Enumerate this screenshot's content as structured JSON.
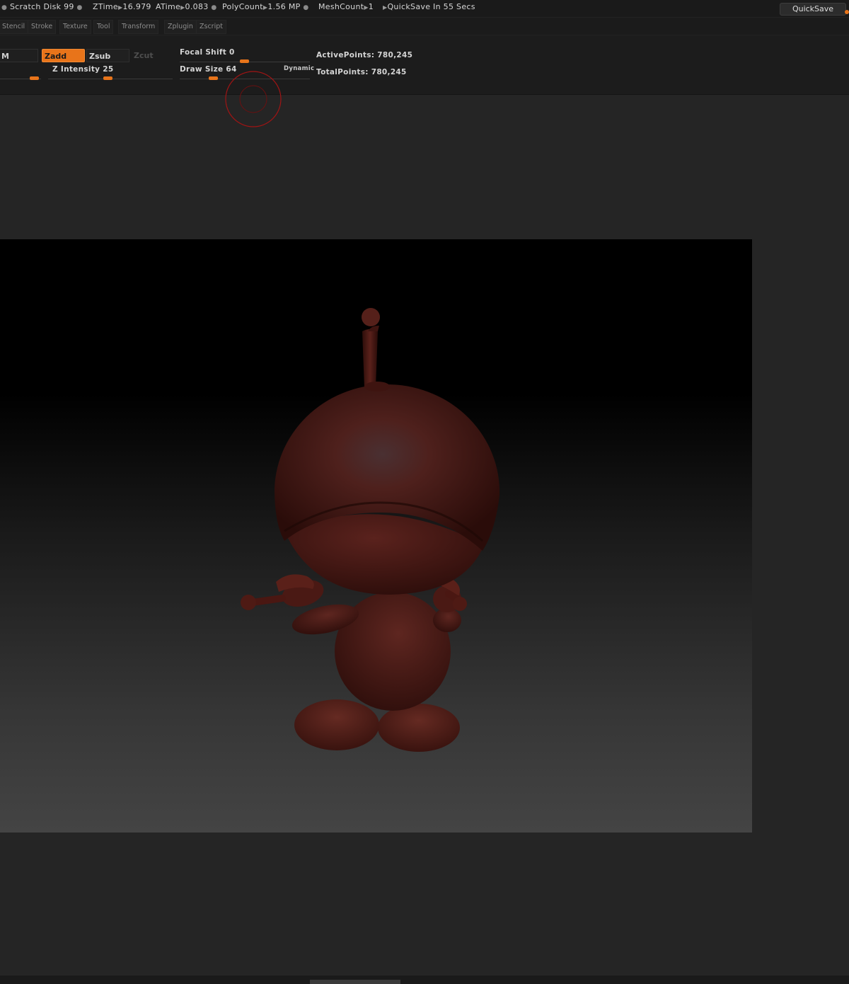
{
  "statusbar": {
    "scratch_disk": "Scratch Disk 99",
    "ztime_label": "ZTime",
    "ztime_value": "16.979",
    "atime_label": "ATime",
    "atime_value": "0.083",
    "polycount_label": "PolyCount",
    "polycount_value": "1.56 MP",
    "meshcount_label": "MeshCount",
    "meshcount_value": "1",
    "quicksave_timer": "QuickSave In 55 Secs",
    "quicksave_button": "QuickSave"
  },
  "menubar": {
    "items": [
      "Stencil",
      "Stroke",
      "Texture",
      "Tool",
      "Transform",
      "Zplugin",
      "Zscript"
    ]
  },
  "shelf": {
    "partial_button": "M",
    "zadd": "Zadd",
    "zsub": "Zsub",
    "zcut": "Zcut",
    "z_intensity_label": "Z Intensity",
    "z_intensity_value": "25",
    "focal_shift_label": "Focal Shift",
    "focal_shift_value": "0",
    "draw_size_label": "Draw Size",
    "draw_size_value": "64",
    "dynamic_label": "Dynamic",
    "active_points_label": "ActivePoints:",
    "active_points_value": "780,245",
    "total_points_label": "TotalPoints:",
    "total_points_value": "780,245"
  },
  "colors": {
    "accent": "#e8741a",
    "model": "#5a1f1a",
    "background": "#222222"
  },
  "icons": {
    "brush_cursor": "brush-circle-icon",
    "status_separator": "bullet-dot-icon",
    "status_arrow": "triangle-right-icon"
  }
}
